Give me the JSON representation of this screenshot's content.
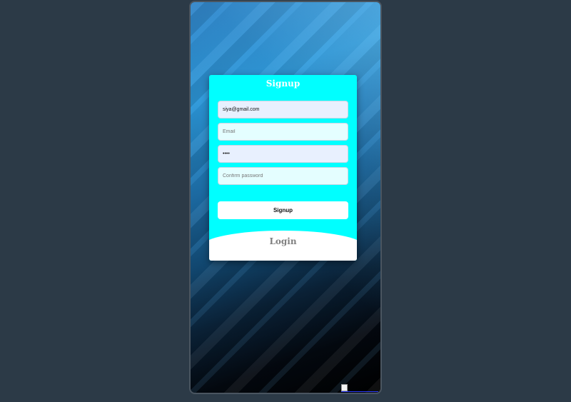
{
  "signup_form": {
    "title": "Signup",
    "fields": {
      "username": {
        "value": "siya@gmail.com",
        "placeholder": ""
      },
      "email": {
        "value": "",
        "placeholder": "Email"
      },
      "password": {
        "value": "••••",
        "placeholder": ""
      },
      "confirm_password": {
        "value": "",
        "placeholder": "Confirm password"
      }
    },
    "signup_button_label": "Signup",
    "login_label": "Login"
  },
  "colors": {
    "card_background": "#00ffff",
    "page_background": "#2c3a47",
    "filled_field": "#e8f0fe",
    "login_text": "#808080"
  },
  "icons": {
    "broken_image": "broken-image-icon"
  }
}
